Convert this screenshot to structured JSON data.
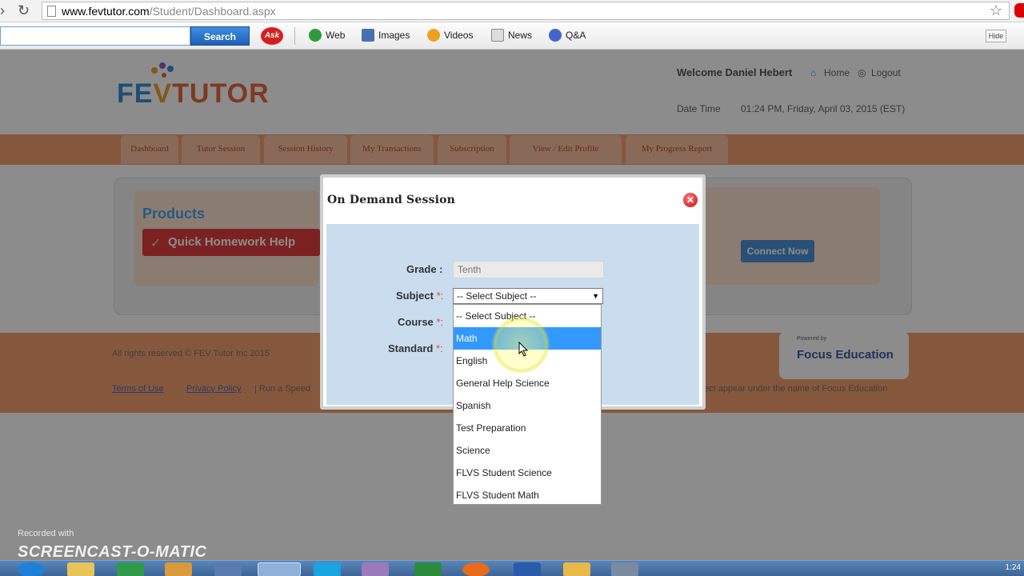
{
  "browser": {
    "url_host": "www.fevtutor.com",
    "url_path": "/Student/Dashboard.aspx"
  },
  "toolbar": {
    "search_button": "Search",
    "ask_logo": "Ask",
    "items": [
      "Web",
      "Images",
      "Videos",
      "News",
      "Q&A"
    ],
    "hide_label": "Hide"
  },
  "site": {
    "logo_fe": "FE",
    "logo_tutor": "TUTOR",
    "welcome": "Welcome  Daniel Hebert",
    "home_link": "Home",
    "logout_link": "Logout",
    "datetime_label": "Date Time",
    "datetime_value": "01:24 PM, Friday, April 03, 2015 (EST)",
    "menu": [
      "Dashboard",
      "Tutor Session",
      "Session History",
      "My Transactions",
      "Subscription",
      "View / Edit Profile",
      "My Progress Report"
    ],
    "products_title": "Products",
    "quick_homework": "Quick Homework Help",
    "connect_now": "Connect Now",
    "footer_copyright": "All rights reserved © FEV Tutor Inc 2015",
    "footer_terms": "Terms of Use",
    "footer_privacy": "Privacy Policy",
    "footer_mid": "| Run a Speed",
    "footer_right": "ect appear under the name of Focus Education",
    "focus_logo": "Focus Education",
    "focus_small": "Powered by"
  },
  "modal": {
    "title": "On Demand Session",
    "grade_label": "Grade :",
    "grade_value": "Tenth",
    "subject_label": "Subject",
    "course_label": "Course",
    "standard_label": "Standard",
    "req_mark": "*:",
    "subject_selected": "-- Select Subject --",
    "options": [
      "-- Select Subject --",
      "Math",
      "English",
      "General Help Science",
      "Spanish",
      "Test Preparation",
      "Science",
      "FLVS Student Science",
      "FLVS Student Math"
    ],
    "highlighted_index": 1
  },
  "watermark": {
    "small": "Recorded with",
    "big": "SCREENCAST-O-MATIC"
  },
  "taskbar": {
    "clock": "1:24"
  }
}
